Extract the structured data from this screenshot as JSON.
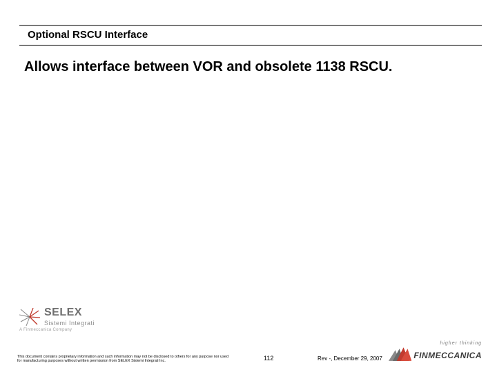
{
  "header": {
    "title": "Optional RSCU Interface"
  },
  "body": {
    "main_text": "Allows interface between VOR and obsolete 1138 RSCU."
  },
  "selex_logo": {
    "word": "SELEX",
    "subtitle": "Sistemi Integrati",
    "tagline": "A Finmeccanica Company"
  },
  "footer": {
    "proprietary": "This document contains proprietary information and such information may not be disclosed to others for any purpose nor used for manufacturing purposes without written permission from SELEX Sistemi Integrati Inc.",
    "page_number": "112",
    "revision_date": "Rev -, December 29, 2007"
  },
  "fin_logo": {
    "tagline": "higher thinking",
    "word": "FINMECCANICA"
  }
}
